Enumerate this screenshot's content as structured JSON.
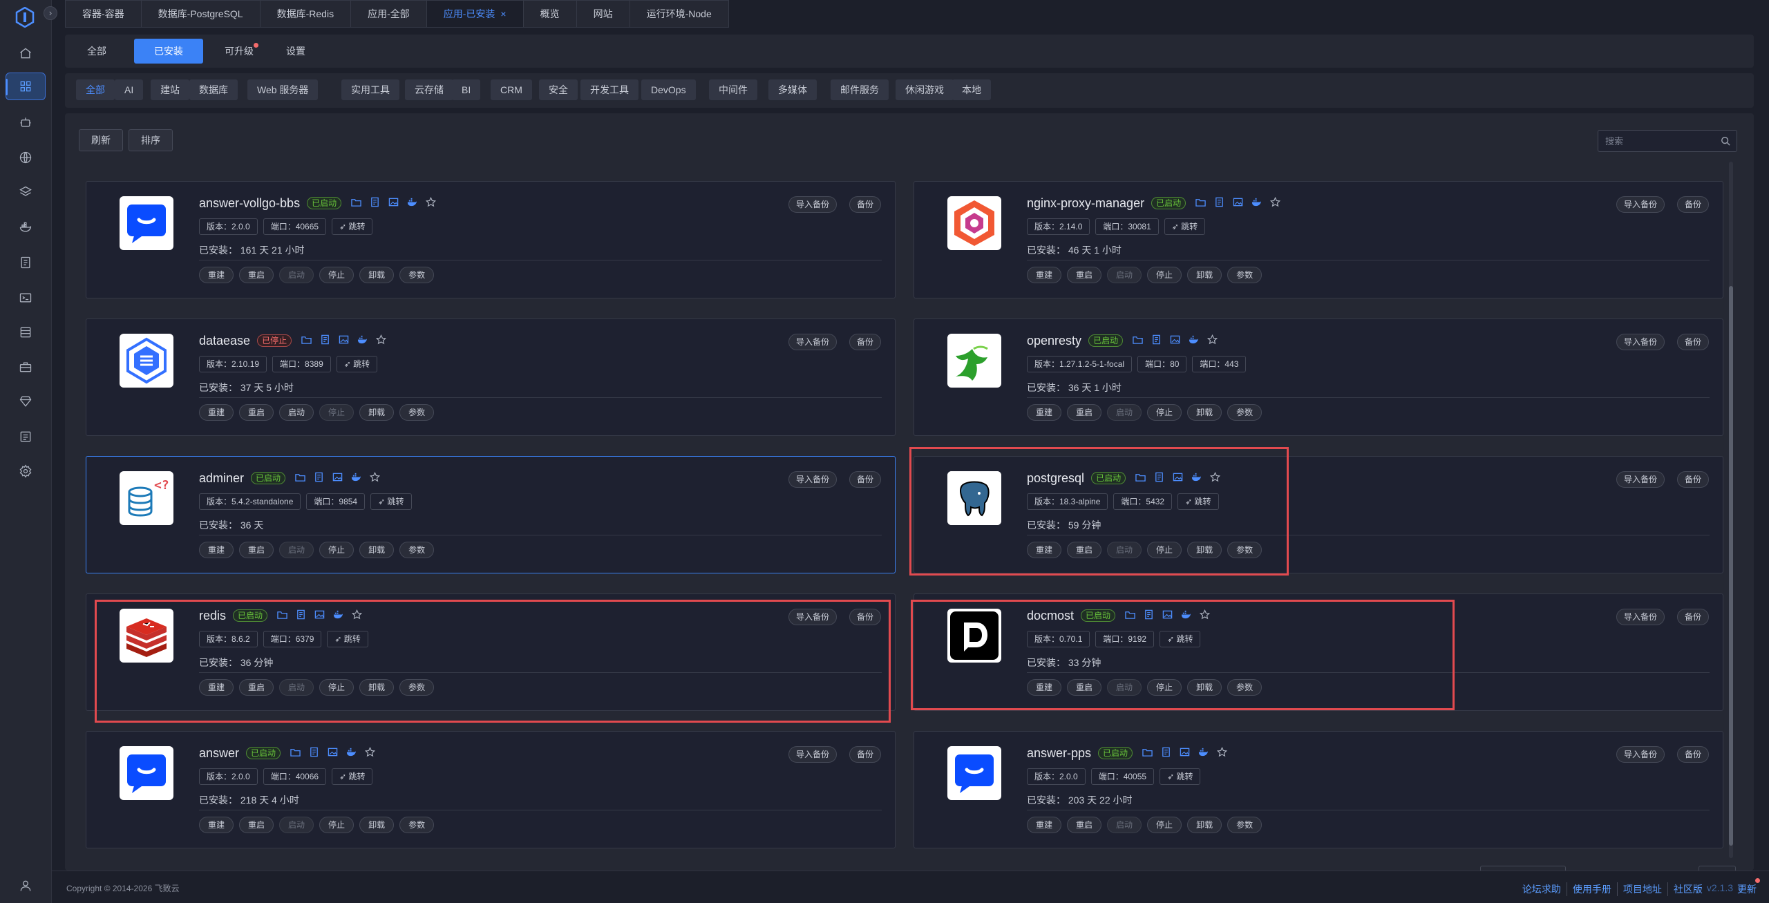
{
  "top_tabs": [
    {
      "label": "容器-容器"
    },
    {
      "label": "数据库-PostgreSQL"
    },
    {
      "label": "数据库-Redis"
    },
    {
      "label": "应用-全部"
    },
    {
      "label": "应用-已安装",
      "active": true
    },
    {
      "label": "概览"
    },
    {
      "label": "网站"
    },
    {
      "label": "运行环境-Node"
    }
  ],
  "sub_tabs": [
    "全部",
    "已安装",
    "可升级",
    "设置"
  ],
  "categories": [
    "全部",
    "AI",
    "建站",
    "数据库",
    "Web 服务器",
    "实用工具",
    "云存储",
    "BI",
    "CRM",
    "安全",
    "开发工具",
    "DevOps",
    "中间件",
    "多媒体",
    "邮件服务",
    "休闲游戏",
    "本地"
  ],
  "toolbar": {
    "refresh": "刷新",
    "sort": "排序",
    "search_placeholder": "搜索"
  },
  "card_labels": {
    "import_backup": "导入备份",
    "backup": "备份",
    "rebuild": "重建",
    "restart": "重启",
    "start": "启动",
    "stop": "停止",
    "uninstall": "卸载",
    "params": "参数",
    "jump": "跳转"
  },
  "apps": [
    {
      "name": "answer-vollgo-bbs",
      "status": "已启动",
      "running": true,
      "version": "版本：2.0.0",
      "ports": [
        "端口：40665"
      ],
      "installed": "已安装：  161 天 21 小时",
      "icon": "answer-icon"
    },
    {
      "name": "nginx-proxy-manager",
      "status": "已启动",
      "running": true,
      "version": "版本：2.14.0",
      "ports": [
        "端口：30081"
      ],
      "installed": "已安装：  46 天 1 小时",
      "icon": "nginx-proxy-manager-icon"
    },
    {
      "name": "dataease",
      "status": "已停止",
      "running": false,
      "version": "版本：2.10.19",
      "ports": [
        "端口：8389"
      ],
      "installed": "已安装：  37 天 5 小时",
      "icon": "dataease-icon"
    },
    {
      "name": "openresty",
      "status": "已启动",
      "running": true,
      "version": "版本：1.27.1.2-5-1-focal",
      "ports": [
        "端口：80",
        "端口：443"
      ],
      "installed": "已安装：  36 天 1 小时",
      "icon": "openresty-icon"
    },
    {
      "name": "adminer",
      "status": "已启动",
      "running": true,
      "version": "版本：5.4.2-standalone",
      "ports": [
        "端口：9854"
      ],
      "installed": "已安装：  36 天",
      "icon": "adminer-icon"
    },
    {
      "name": "postgresql",
      "status": "已启动",
      "running": true,
      "version": "版本：18.3-alpine",
      "ports": [
        "端口：5432"
      ],
      "installed": "已安装：  59 分钟",
      "icon": "postgresql-icon"
    },
    {
      "name": "redis",
      "status": "已启动",
      "running": true,
      "version": "版本：8.6.2",
      "ports": [
        "端口：6379"
      ],
      "installed": "已安装：  36 分钟",
      "icon": "redis-icon"
    },
    {
      "name": "docmost",
      "status": "已启动",
      "running": true,
      "version": "版本：0.70.1",
      "ports": [
        "端口：9192"
      ],
      "installed": "已安装：  33 分钟",
      "icon": "docmost-icon"
    },
    {
      "name": "answer",
      "status": "已启动",
      "running": true,
      "version": "版本：2.0.0",
      "ports": [
        "端口：40066"
      ],
      "installed": "已安装：  218 天 4 小时",
      "icon": "answer-icon"
    },
    {
      "name": "answer-pps",
      "status": "已启动",
      "running": true,
      "version": "版本：2.0.0",
      "ports": [
        "端口：40055"
      ],
      "installed": "已安装：  203 天 22 小时",
      "icon": "answer-icon"
    }
  ],
  "footer": {
    "copyright": "Copyright © 2014-2026 飞致云",
    "links": [
      "论坛求助",
      "使用手册",
      "项目地址",
      "社区版"
    ],
    "version": "v2.1.3",
    "update": "更新"
  },
  "colors": {
    "accent": "#3b82f6",
    "running": "#67c23a",
    "stopped": "#f56c6c",
    "highlight": "#e24a4f"
  }
}
